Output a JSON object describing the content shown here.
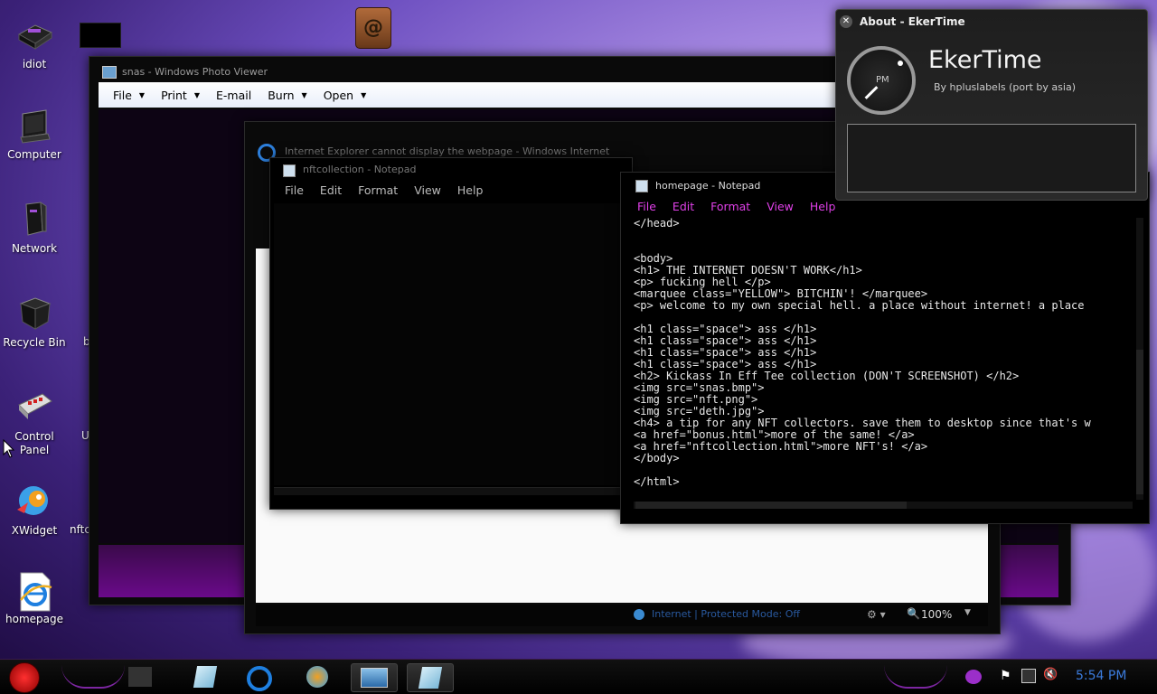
{
  "desktop": {
    "icons": [
      {
        "label": "idiot"
      },
      {
        "label": "Computer"
      },
      {
        "label": "Network"
      },
      {
        "label": "Recycle Bin"
      },
      {
        "label": "Control Panel"
      },
      {
        "label": "XWidget"
      },
      {
        "label": "homepage"
      }
    ],
    "partial_icons": [
      "b",
      "U",
      "nftc"
    ]
  },
  "photo_viewer": {
    "title": "snas - Windows Photo Viewer",
    "menu": [
      "File",
      "Print",
      "E-mail",
      "Burn",
      "Open"
    ]
  },
  "ie": {
    "title": "Internet Explorer cannot display the webpage - Windows Internet Explorer",
    "status": "Internet | Protected Mode: Off",
    "zoom": "100%"
  },
  "notepad_nft": {
    "title": "nftcollection - Notepad",
    "menu": [
      "File",
      "Edit",
      "Format",
      "View",
      "Help"
    ]
  },
  "notepad_home": {
    "title": "homepage - Notepad",
    "menu": [
      "File",
      "Edit",
      "Format",
      "View",
      "Help"
    ],
    "lines": [
      "</head>",
      "",
      "",
      "<body>",
      "<h1> THE INTERNET DOESN'T WORK</h1>",
      "<p> fucking hell </p>",
      "<marquee class=\"YELLOW\"> BITCHIN'! </marquee>",
      "<p> welcome to my own special hell. a place without internet! a place",
      "",
      "<h1 class=\"space\"> ass </h1>",
      "<h1 class=\"space\"> ass </h1>",
      "<h1 class=\"space\"> ass </h1>",
      "<h1 class=\"space\"> ass </h1>",
      "<h2> Kickass In Eff Tee collection (DON'T SCREENSHOT) </h2>",
      "<img src=\"snas.bmp\">",
      "<img src=\"nft.png\">",
      "<img src=\"deth.jpg\">",
      "<h4> a tip for any NFT collectors. save them to desktop since that's w",
      "<a href=\"bonus.html\">more of the same! </a>",
      "<a href=\"nftcollection.html\">more NFT's! </a>",
      "</body>",
      "",
      "</html>"
    ]
  },
  "about_ekertime": {
    "title": "About - EkerTime",
    "app_name": "EkerTime",
    "byline": "By hpluslabels (port by asia)",
    "clock_label": "PM"
  },
  "taskbar": {
    "clock": "5:54 PM"
  },
  "colors": {
    "accent_purple": "#9b2fc9",
    "menu_pink": "#e040e8",
    "clock_blue": "#3b7bdc"
  }
}
